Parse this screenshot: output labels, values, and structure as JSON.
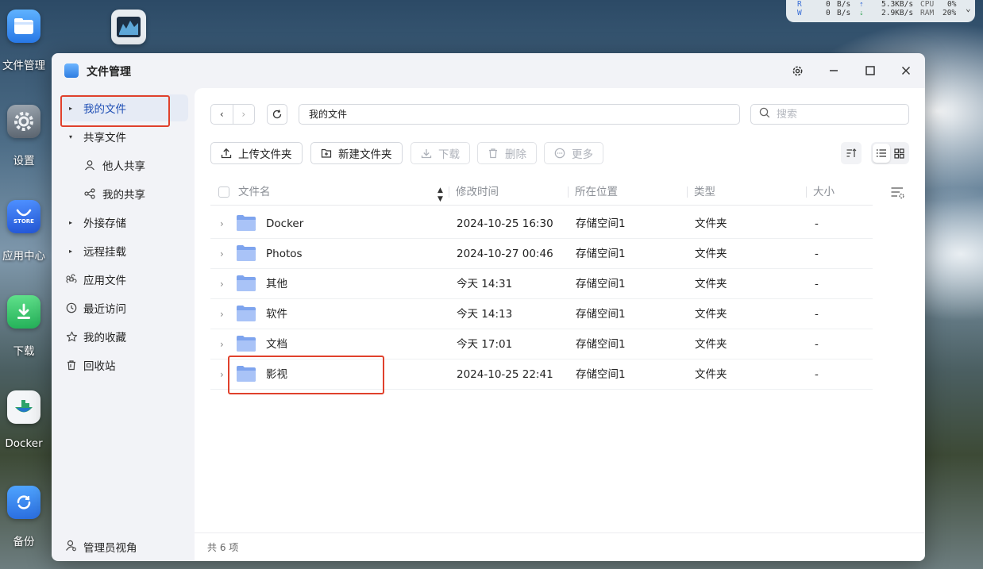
{
  "desktop": {
    "icons": [
      {
        "label": "文件管理",
        "icon": "file-manager-icon"
      },
      {
        "label": "设置",
        "icon": "gear-icon"
      },
      {
        "label": "应用中心",
        "icon": "store-icon",
        "badge": "STORE"
      },
      {
        "label": "下载",
        "icon": "download-icon"
      },
      {
        "label": "Docker",
        "icon": "docker-icon"
      },
      {
        "label": "备份",
        "icon": "backup-icon"
      }
    ],
    "monitor_icon": "resource-monitor-icon"
  },
  "stats": {
    "r_label": "R",
    "r_value": "0",
    "r_unit": "B/s",
    "w_label": "W",
    "w_value": "0",
    "w_unit": "B/s",
    "up_speed": "5.3KB/s",
    "down_speed": "2.9KB/s",
    "cpu_label": "CPU",
    "cpu_value": "0%",
    "ram_label": "RAM",
    "ram_value": "20%"
  },
  "window": {
    "title": "文件管理"
  },
  "sidebar": {
    "items": [
      {
        "label": "我的文件"
      },
      {
        "label": "共享文件"
      },
      {
        "label": "他人共享"
      },
      {
        "label": "我的共享"
      },
      {
        "label": "外接存储"
      },
      {
        "label": "远程挂载"
      },
      {
        "label": "应用文件"
      },
      {
        "label": "最近访问"
      },
      {
        "label": "我的收藏"
      },
      {
        "label": "回收站"
      }
    ],
    "admin_label": "管理员视角"
  },
  "toolbar": {
    "path": "我的文件",
    "search_placeholder": "搜索",
    "upload_folder": "上传文件夹",
    "new_folder": "新建文件夹",
    "download": "下载",
    "delete": "删除",
    "more": "更多"
  },
  "table": {
    "headers": {
      "name": "文件名",
      "modified": "修改时间",
      "location": "所在位置",
      "type": "类型",
      "size": "大小"
    },
    "rows": [
      {
        "name": "Docker",
        "modified": "2024-10-25 16:30",
        "location": "存储空间1",
        "type": "文件夹",
        "size": "-"
      },
      {
        "name": "Photos",
        "modified": "2024-10-27 00:46",
        "location": "存储空间1",
        "type": "文件夹",
        "size": "-"
      },
      {
        "name": "其他",
        "modified": "今天 14:31",
        "location": "存储空间1",
        "type": "文件夹",
        "size": "-"
      },
      {
        "name": "软件",
        "modified": "今天 14:13",
        "location": "存储空间1",
        "type": "文件夹",
        "size": "-"
      },
      {
        "name": "文档",
        "modified": "今天 17:01",
        "location": "存储空间1",
        "type": "文件夹",
        "size": "-"
      },
      {
        "name": "影视",
        "modified": "2024-10-25 22:41",
        "location": "存储空间1",
        "type": "文件夹",
        "size": "-"
      }
    ]
  },
  "footer": {
    "count": "共 6 项"
  },
  "colors": {
    "accent": "#1f4fb5",
    "highlight": "#e0412c",
    "folder": "#8fb2f5"
  }
}
